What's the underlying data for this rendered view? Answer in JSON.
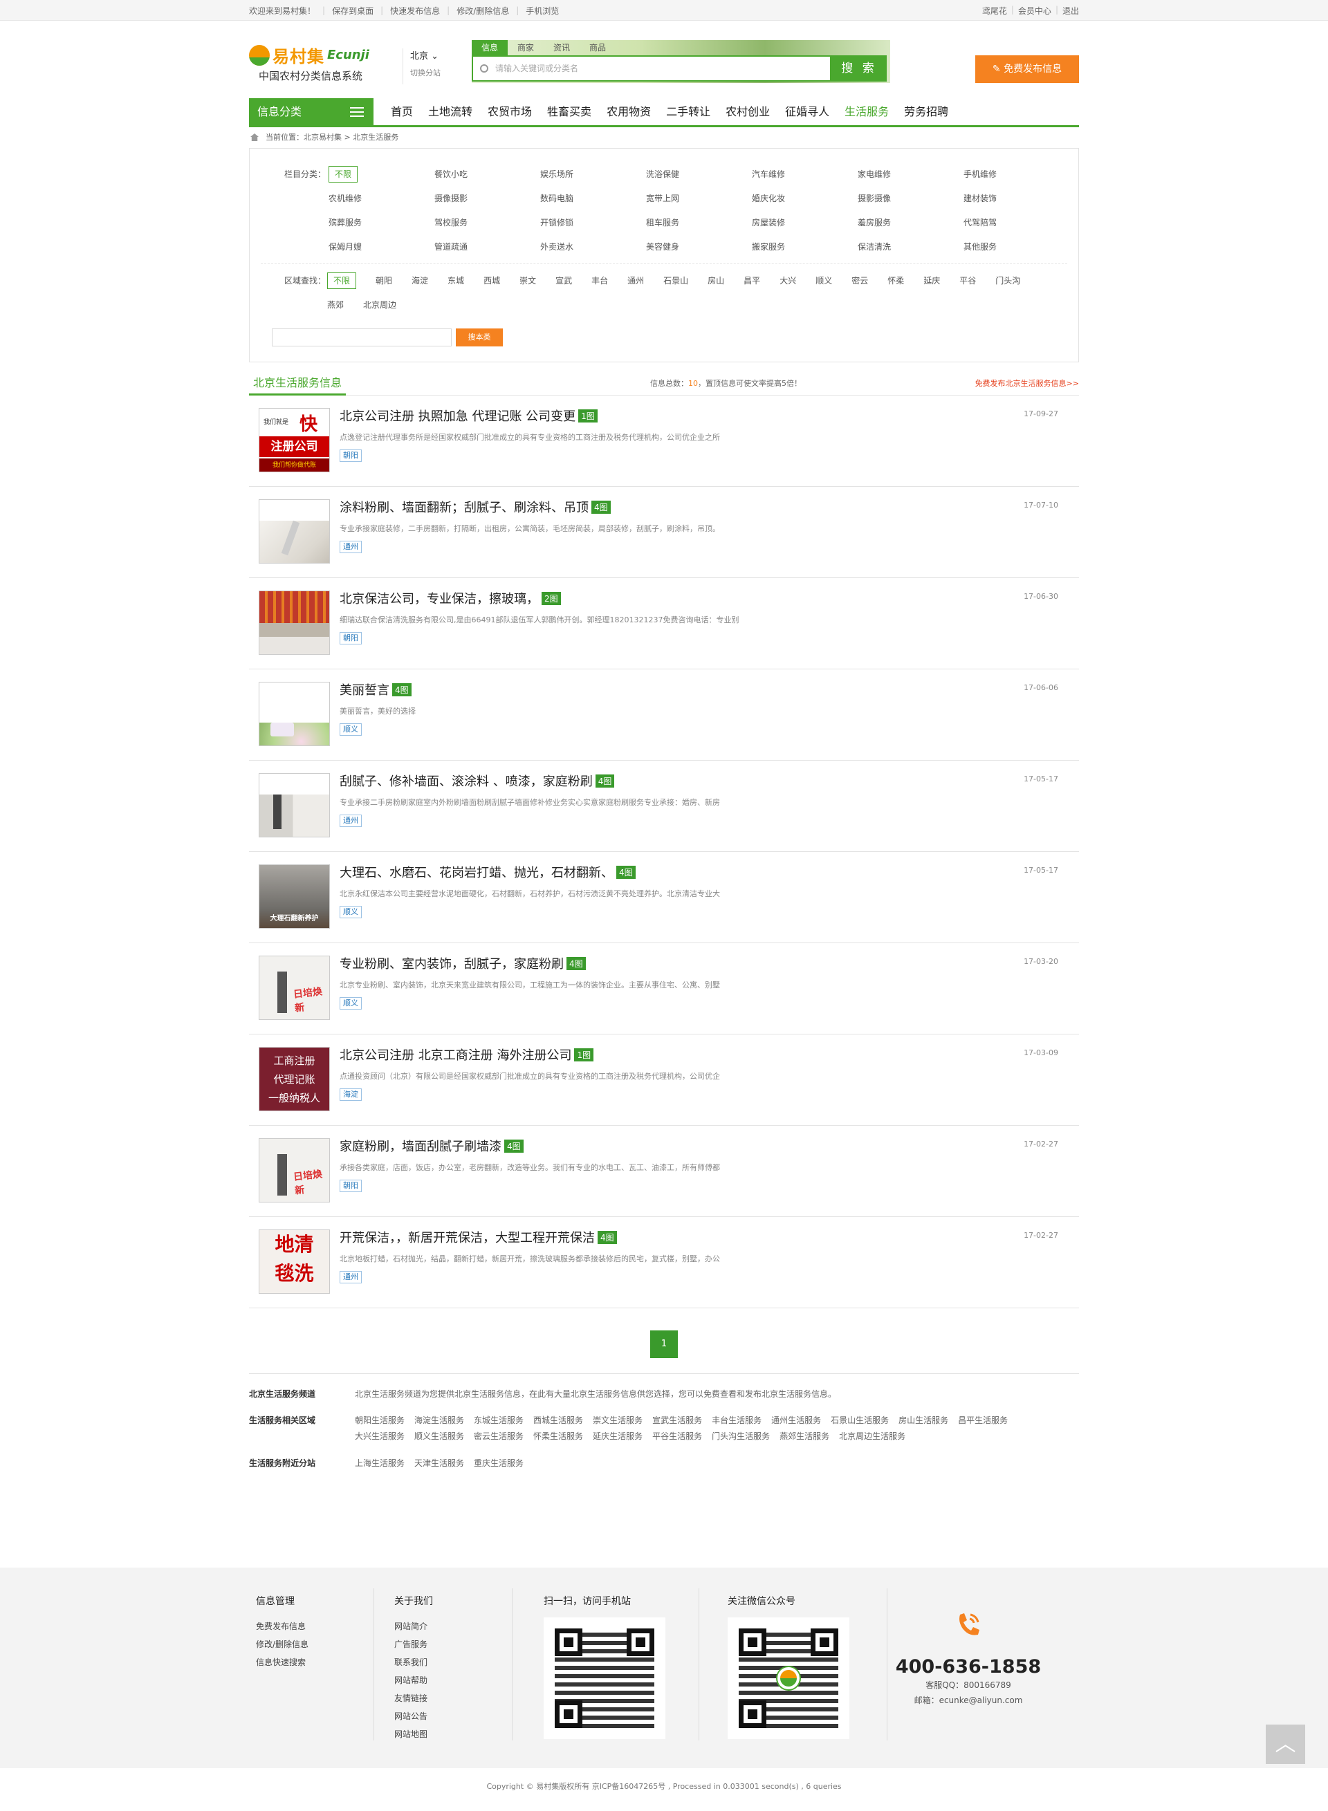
{
  "topbar": {
    "welcome": "欢迎来到易村集！",
    "links": [
      "保存到桌面",
      "快速发布信息",
      "修改/删除信息",
      "手机浏览"
    ],
    "user": "鸢尾花",
    "member": "会员中心",
    "logout": "退出"
  },
  "logo": {
    "cn": "易村集",
    "en": "Ecunji",
    "sub": "中国农村分类信息系统"
  },
  "city": {
    "name": "北京",
    "switch": "切换分站"
  },
  "search": {
    "tabs": [
      "信息",
      "商家",
      "资讯",
      "商品"
    ],
    "placeholder": "请输入关键词或分类名",
    "button": "搜 索"
  },
  "post_button": "免费发布信息",
  "nav": {
    "category": "信息分类",
    "items": [
      "首页",
      "土地流转",
      "农贸市场",
      "牲畜买卖",
      "农用物资",
      "二手转让",
      "农村创业",
      "征婚寻人",
      "生活服务",
      "劳务招聘"
    ],
    "active": "生活服务"
  },
  "breadcrumb": "当前位置：北京易村集 > 北京生活服务",
  "filter": {
    "cat_label": "栏目分类：",
    "categories": [
      "不限",
      "餐饮小吃",
      "娱乐场所",
      "洗浴保健",
      "汽车维修",
      "家电维修",
      "手机维修",
      "农机维修",
      "摄像摄影",
      "数码电脑",
      "宽带上网",
      "婚庆化妆",
      "摄影摄像",
      "建材装饰",
      "殡葬服务",
      "驾校服务",
      "开锁修锁",
      "租车服务",
      "房屋装修",
      "羞房服务",
      "代驾陪驾",
      "保姆月嫂",
      "管道疏通",
      "外卖送水",
      "美容健身",
      "搬家服务",
      "保洁清洗",
      "其他服务"
    ],
    "area_label": "区域查找：",
    "areas": [
      "不限",
      "朝阳",
      "海淀",
      "东城",
      "西城",
      "崇文",
      "宣武",
      "丰台",
      "通州",
      "石景山",
      "房山",
      "昌平",
      "大兴",
      "顺义",
      "密云",
      "怀柔",
      "延庆",
      "平谷",
      "门头沟",
      "燕郊",
      "北京周边"
    ],
    "search_button": "搜本类"
  },
  "list": {
    "title": "北京生活服务信息",
    "count_prefix": "信息总数：",
    "count": "10",
    "count_suffix": "，置顶信息可使文率提高5倍！",
    "post_link": "免费发布北京生活服务信息>>",
    "items": [
      {
        "title": "北京公司注册 执照加急 代理记账 公司变更",
        "pics": "1图",
        "desc": "点逸登记注册代理事务所是经国家权威部门批准成立的具有专业资格的工商注册及税务代理机构，公司优企业之所",
        "area": "朝阳",
        "date": "17-09-27",
        "thumb": "register"
      },
      {
        "title": "涂料粉刷、墙面翻新；刮腻子、刷涂料、吊顶",
        "pics": "4图",
        "desc": "专业承接家庭装修，二手房翻新，打隔断，出租房，公寓简装，毛坯房简装，局部装修，刮腻子，刷涂料，吊顶。",
        "area": "通州",
        "date": "17-07-10",
        "thumb": "wall"
      },
      {
        "title": "北京保洁公司，专业保洁，擦玻璃，",
        "pics": "2图",
        "desc": "细瑞达联合保洁清洗服务有限公司,是由66491部队退伍军人郭鹏伟开创。郭经理18201321237免费咨询电话：专业别",
        "area": "朝阳",
        "date": "17-06-30",
        "thumb": "roof"
      },
      {
        "title": "美丽誓言",
        "pics": "4图",
        "desc": "美丽誓言，美好的选择",
        "area": "顺义",
        "date": "17-06-06",
        "thumb": "flower"
      },
      {
        "title": "刮腻子、修补墙面、滚涂料 、喷漆，家庭粉刷",
        "pics": "4图",
        "desc": "专业承接二手房粉刷家庭室内外粉刷墙面粉刷刮腻子墙面修补修业务实心实意家庭粉刷服务专业承接：婚房、新房",
        "area": "通州",
        "date": "17-05-17",
        "thumb": "wall2"
      },
      {
        "title": "大理石、水磨石、花岗岩打蜡、抛光，石材翻新、",
        "pics": "4图",
        "desc": "北京永红保洁本公司主要经营水泥地面硬化，石材翻新，石材养护，石材污渍泛黄不亮处理养护。北京清洁专业大",
        "area": "顺义",
        "date": "17-05-17",
        "thumb": "marble"
      },
      {
        "title": "专业粉刷、室内装饰，刮腻子，家庭粉刷",
        "pics": "4图",
        "desc": "北京专业粉刷、室内装饰，北京天来宽业建筑有限公司，工程施工为一体的装饰企业。主要从事住宅、公寓、别墅",
        "area": "顺义",
        "date": "17-03-20",
        "thumb": "paint"
      },
      {
        "title": "北京公司注册 北京工商注册 海外注册公司",
        "pics": "1图",
        "desc": "点通投资顾问（北京）有限公司是经国家权威部门批准成立的具有专业资格的工商注册及税务代理机构，公司优企",
        "area": "海淀",
        "date": "17-03-09",
        "thumb": "biz"
      },
      {
        "title": "家庭粉刷，墙面刮腻子刷墙漆",
        "pics": "4图",
        "desc": "承接各类家庭，店面，饭店，办公室，老房翻新，改造等业务。我们有专业的水电工、瓦工、油漆工，所有师傅都",
        "area": "朝阳",
        "date": "17-02-27",
        "thumb": "paint"
      },
      {
        "title": "开荒保洁，，新居开荒保洁，大型工程开荒保洁",
        "pics": "4图",
        "desc": "北京地板打蜡，石材抛光，结晶，翻新打蜡，新居开荒，擦洗玻璃服务都承接装修后的民宅，复式楼，别墅，办公",
        "area": "通州",
        "date": "17-02-27",
        "thumb": "clean"
      }
    ]
  },
  "thumb_text": {
    "register_a": "我们就是",
    "register_b": "快",
    "register_c": "注册公司",
    "register_d": "我们帮你做代账",
    "biz": [
      "工商注册",
      "代理记账",
      "一般纳税人"
    ],
    "marble": "大理石翻新养护",
    "paint": "日培焕新",
    "clean": [
      "地清",
      "毯洗"
    ]
  },
  "pager": "1",
  "seo": {
    "channel_label": "北京生活服务频道",
    "channel_text": "北京生活服务频道为您提供北京生活服务信息，在此有大量北京生活服务信息供您选择，您可以免费查看和发布北京生活服务信息。",
    "area_label": "生活服务相关区域",
    "area_links": [
      "朝阳生活服务",
      "海淀生活服务",
      "东城生活服务",
      "西城生活服务",
      "崇文生活服务",
      "宣武生活服务",
      "丰台生活服务",
      "通州生活服务",
      "石景山生活服务",
      "房山生活服务",
      "昌平生活服务",
      "大兴生活服务",
      "顺义生活服务",
      "密云生活服务",
      "怀柔生活服务",
      "延庆生活服务",
      "平谷生活服务",
      "门头沟生活服务",
      "燕郊生活服务",
      "北京周边生活服务"
    ],
    "near_label": "生活服务附近分站",
    "near_links": [
      "上海生活服务",
      "天津生活服务",
      "重庆生活服务"
    ]
  },
  "footer": {
    "col1": {
      "title": "信息管理",
      "links": [
        "免费发布信息",
        "修改/删除信息",
        "信息快速搜索"
      ]
    },
    "col2": {
      "title": "关于我们",
      "links": [
        "网站简介",
        "广告服务",
        "联系我们",
        "网站帮助",
        "友情链接",
        "网站公告",
        "网站地图"
      ]
    },
    "col3": {
      "title": "扫一扫，访问手机站"
    },
    "col4": {
      "title": "关注微信公众号"
    },
    "phone": "400-636-1858",
    "qq": "客服QQ：800166789",
    "mail": "邮箱：ecunke@aliyun.com"
  },
  "copyright": "Copyright © 易村集版权所有 京ICP备16047265号 , Processed in 0.033001 second(s) , 6 queries",
  "colors": {
    "green": "#4aa82e",
    "orange": "#f58220"
  }
}
